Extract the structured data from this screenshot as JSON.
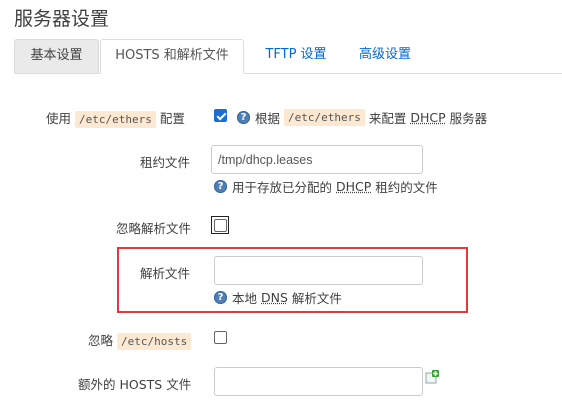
{
  "page": {
    "title": "服务器设置"
  },
  "tabs": [
    {
      "label": "基本设置"
    },
    {
      "label": "HOSTS 和解析文件"
    },
    {
      "label": "TFTP 设置"
    },
    {
      "label": "高级设置"
    }
  ],
  "ethers": {
    "label_prefix": "使用",
    "code": "/etc/ethers",
    "label_suffix": "配置",
    "checked": true,
    "help_prefix": "根据",
    "help_code": "/etc/ethers",
    "help_mid": "来配置",
    "help_abbr": "DHCP",
    "help_suffix": "服务器"
  },
  "leasefile": {
    "label": "租约文件",
    "value": "/tmp/dhcp.leases",
    "help_prefix": "用于存放已分配的",
    "help_abbr": "DHCP",
    "help_suffix": "租约的文件"
  },
  "ignore_resolv": {
    "label": "忽略解析文件",
    "checked": false
  },
  "resolvfile": {
    "label": "解析文件",
    "value": "",
    "help_prefix": "本地",
    "help_abbr": "DNS",
    "help_suffix": "解析文件"
  },
  "ignore_hosts": {
    "label_prefix": "忽略",
    "code": "/etc/hosts",
    "checked": false
  },
  "extra_hosts": {
    "label": "额外的 HOSTS 文件",
    "value": ""
  },
  "icons": {
    "help": "help-icon",
    "add": "add-icon"
  },
  "colors": {
    "accent": "#1b6ed2",
    "link": "#0069d6",
    "highlight": "#e03a3a",
    "code_bg": "#fde9d2"
  }
}
